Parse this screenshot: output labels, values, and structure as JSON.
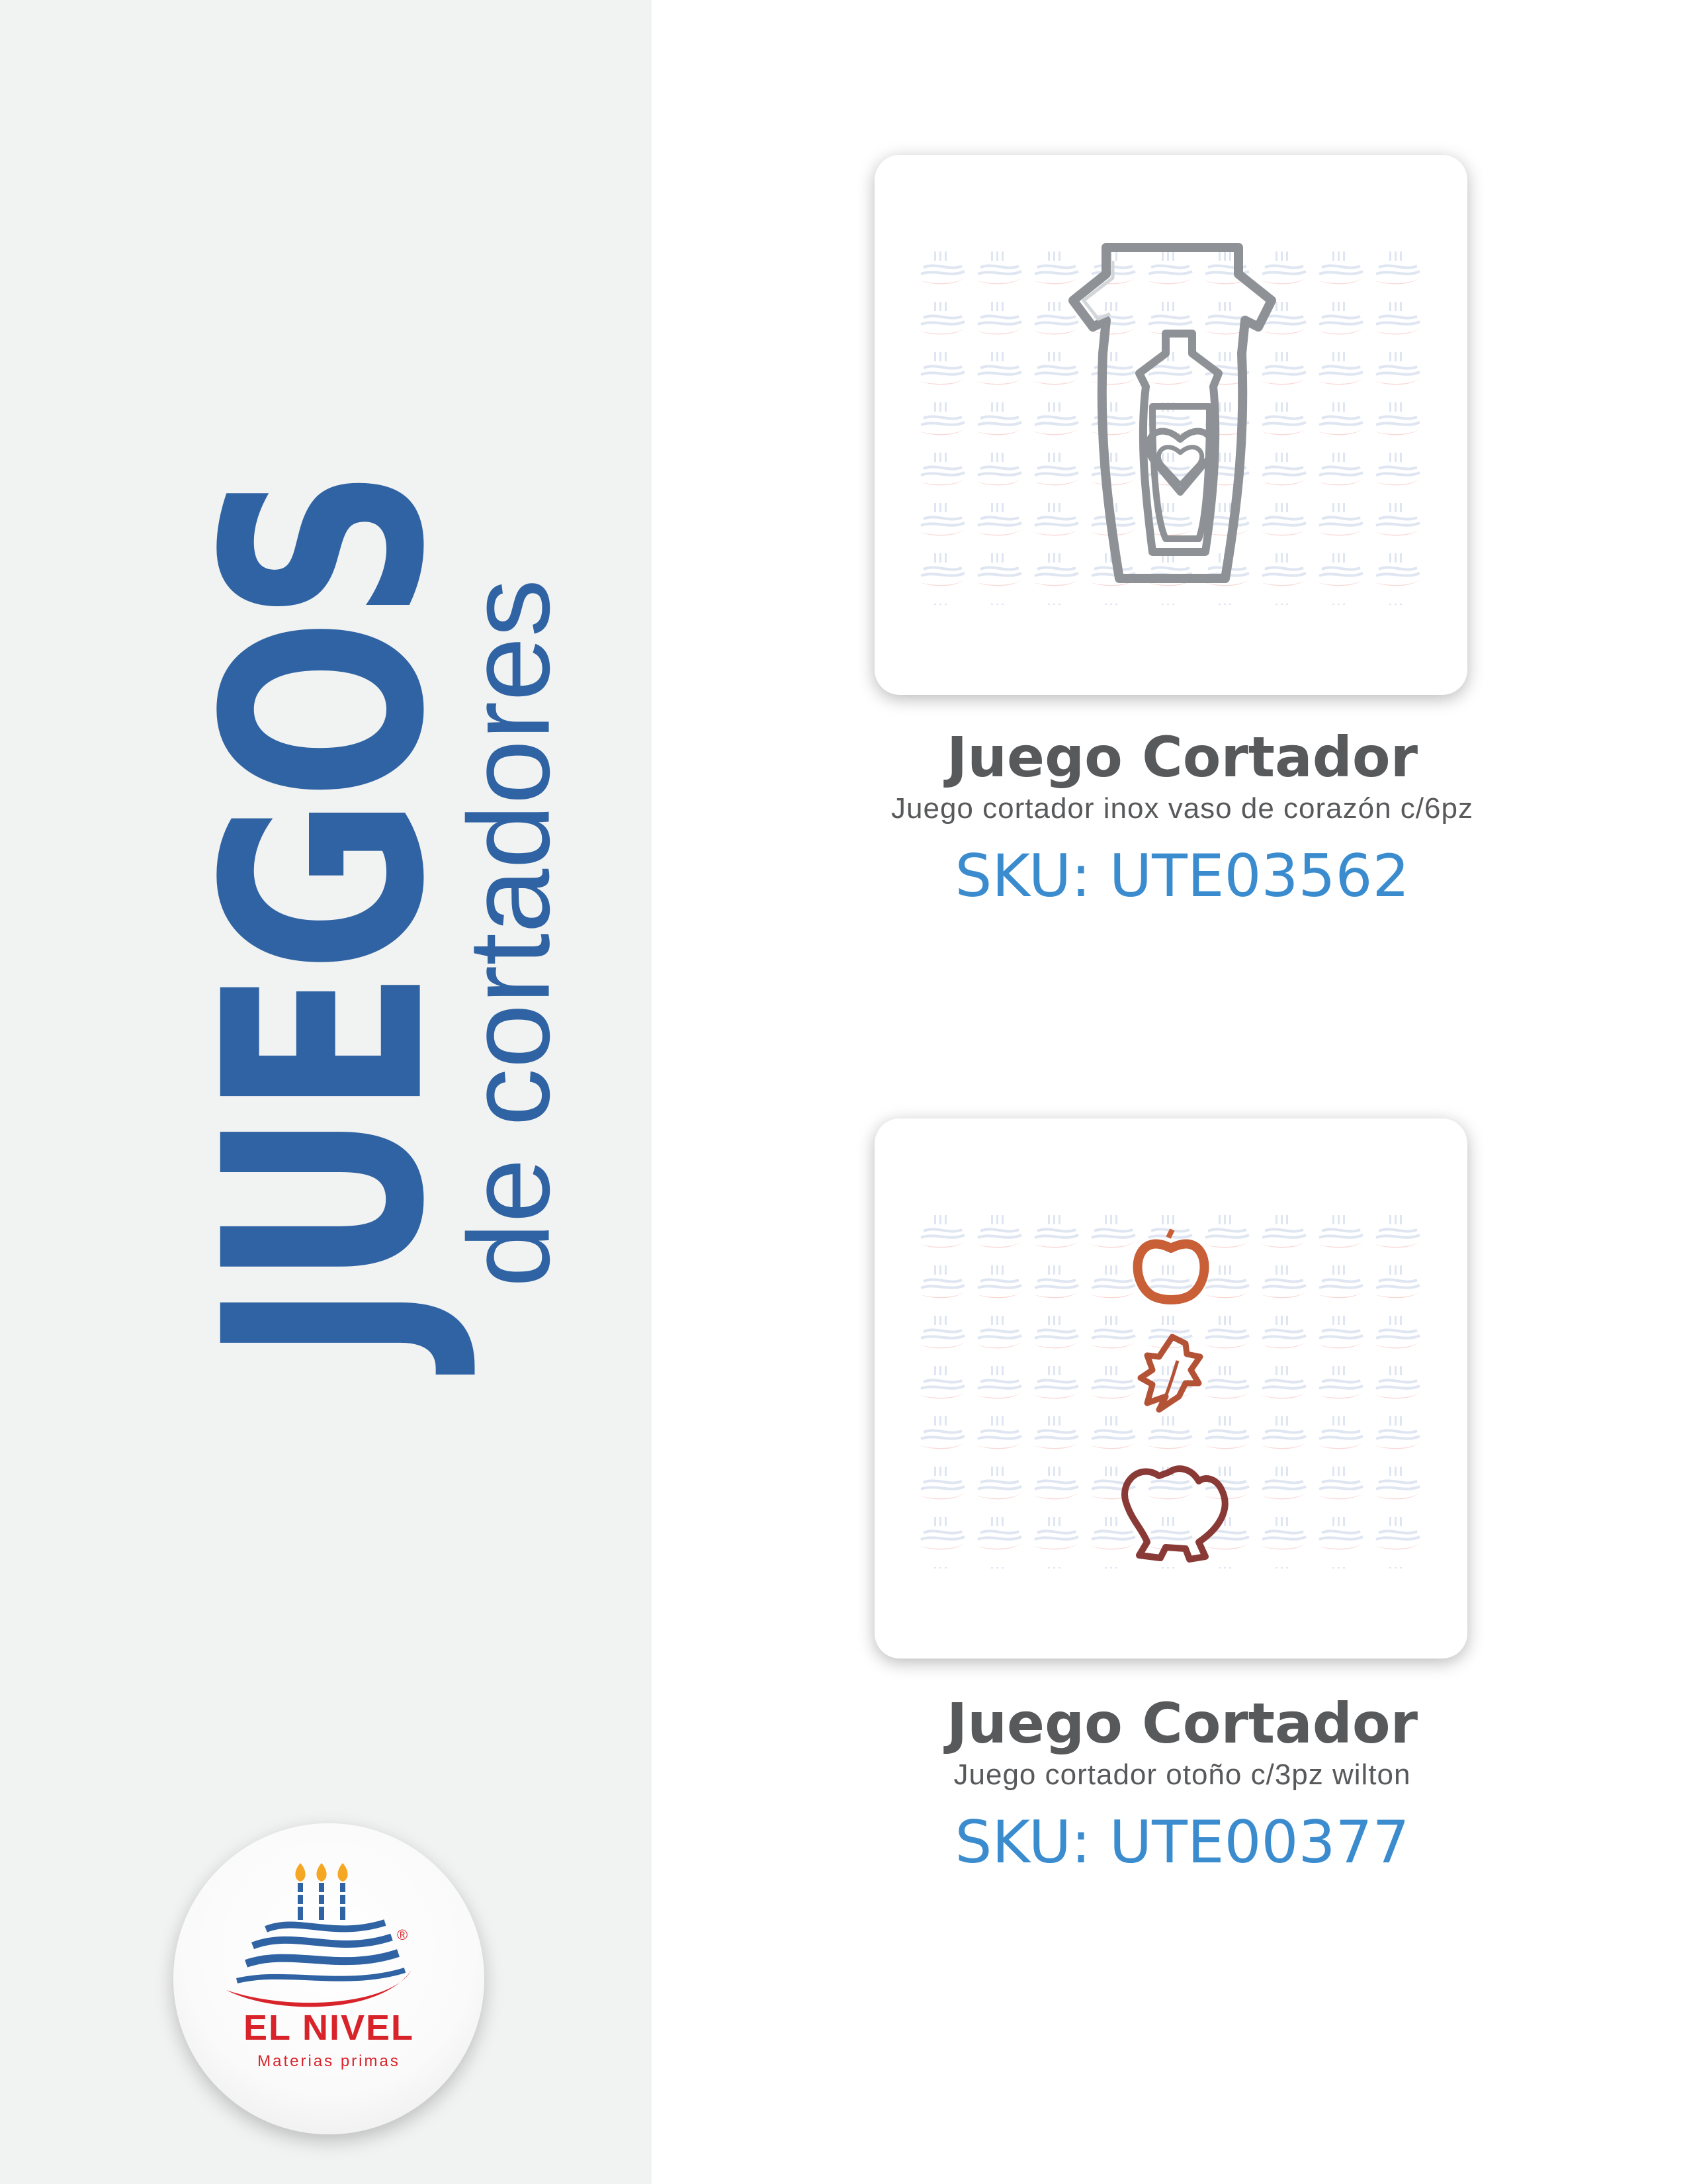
{
  "sidebar": {
    "title_main": "JUEGOS",
    "title_sub": "de cortadores"
  },
  "brand": {
    "name": "EL NIVEL",
    "tagline": "Materias primas",
    "registered": "®",
    "colors": {
      "red": "#d8232a",
      "blue": "#2f63a3",
      "orange": "#f5a623"
    }
  },
  "products": [
    {
      "title": "Juego Cortador",
      "description": "Juego cortador inox vaso de corazón c/6pz",
      "sku": "SKU: UTE03562",
      "image": "stainless-cup-heart-cutter-set"
    },
    {
      "title": "Juego Cortador",
      "description": "Juego cortador otoño c/3pz wilton",
      "sku": "SKU: UTE00377",
      "image": "autumn-copper-cutter-set"
    }
  ],
  "colors": {
    "accent": "#2f63a3",
    "sku": "#3a8ccf",
    "text": "#58595b",
    "sidebar_bg": "#f1f2f2"
  }
}
